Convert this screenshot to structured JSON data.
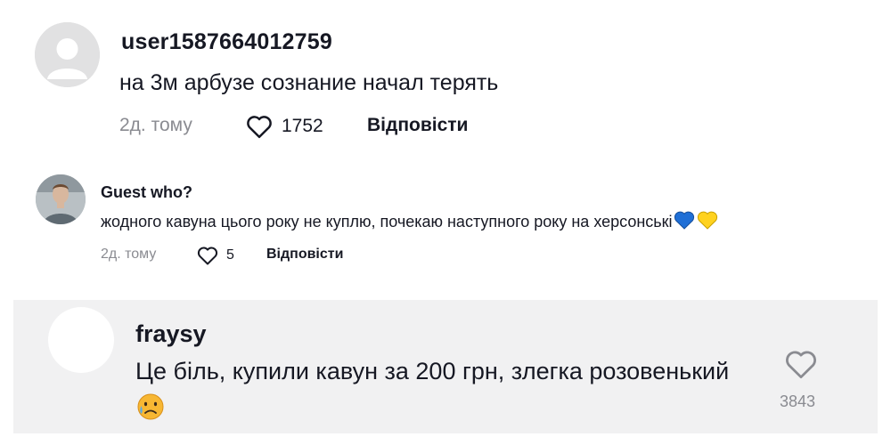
{
  "comments": [
    {
      "username": "user1587664012759",
      "text": "на 3м арбузе сознание начал терять",
      "time": "2д. тому",
      "likes": "1752",
      "reply_label": "Відповісти"
    },
    {
      "username": "Guest who?",
      "text": "жодного кавуна цього року не куплю, почекаю наступного року на херсонські",
      "emojis": [
        "blue-heart-icon",
        "yellow-heart-icon"
      ],
      "time": "2д. тому",
      "likes": "5",
      "reply_label": "Відповісти"
    },
    {
      "username": "fraysy",
      "text": "Це біль, купили кавун за 200 грн, злегка розовенький",
      "emojis": [
        "sad-tear-face-icon"
      ],
      "likes": "3843"
    }
  ],
  "colors": {
    "text": "#161823",
    "secondary": "#8a8b91",
    "highlight_bg": "#f1f1f2",
    "avatar_placeholder": "#e1e1e2",
    "heart_blue": "#1f6fd6",
    "heart_yellow": "#ffd21f"
  }
}
